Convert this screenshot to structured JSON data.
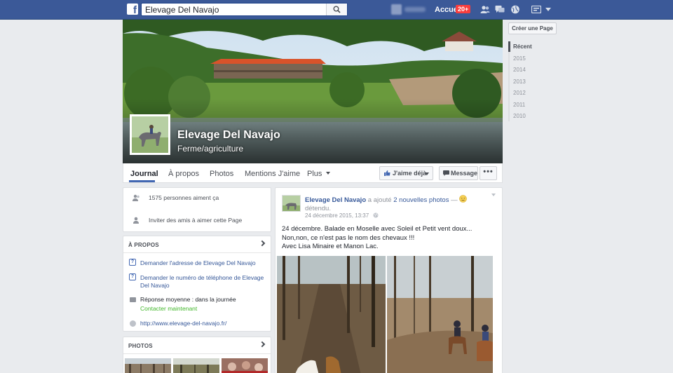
{
  "topbar": {
    "search_value": "Elevage Del Navajo",
    "home_label": "Accueil",
    "notif_count": "20+",
    "icons": [
      "friends-icon",
      "messages-icon",
      "notifications-icon",
      "settings-icon",
      "account-caret-icon"
    ]
  },
  "cover": {
    "page_name": "Elevage Del Navajo",
    "category": "Ferme/agriculture"
  },
  "tabs": {
    "items": [
      "Journal",
      "À propos",
      "Photos",
      "Mentions J'aime",
      "Plus"
    ],
    "like_button": "J'aime déjà",
    "message_button": "Message",
    "more_button": "•••"
  },
  "sidebar": {
    "likes": "1575 personnes aiment ça",
    "invite": "Inviter des amis à aimer cette Page",
    "about": {
      "title": "À PROPOS",
      "ask_address": "Demander l'adresse de Elevage Del Navajo",
      "ask_phone": "Demander le numéro de téléphone de Elevage Del Navajo",
      "response": "Réponse moyenne : dans la journée",
      "contact": "Contacter maintenant",
      "website": "http://www.elevage-del-navajo.fr/"
    },
    "photos_title": "PHOTOS"
  },
  "post": {
    "author": "Elevage Del Navajo",
    "action": "a ajouté",
    "photos_link": "2 nouvelles photos",
    "feeling_dash": "—",
    "feeling": "détendu.",
    "time": "24 décembre 2015, 13:37",
    "body_line1": "24 décembre. Balade en Moselle avec Soleil et Petit vent doux... Non,non, ce n'est pas le nom des chevaux !!!",
    "body_line2": "Avec Lisa Minaire et Manon Lac."
  },
  "right": {
    "create_page": "Créer une Page",
    "years": [
      "Récent",
      "2015",
      "2014",
      "2013",
      "2012",
      "2011",
      "2010"
    ]
  },
  "colors": {
    "topbar": "#3b5998",
    "link": "#365899",
    "accent": "#4267b2",
    "green": "#42b72a"
  }
}
